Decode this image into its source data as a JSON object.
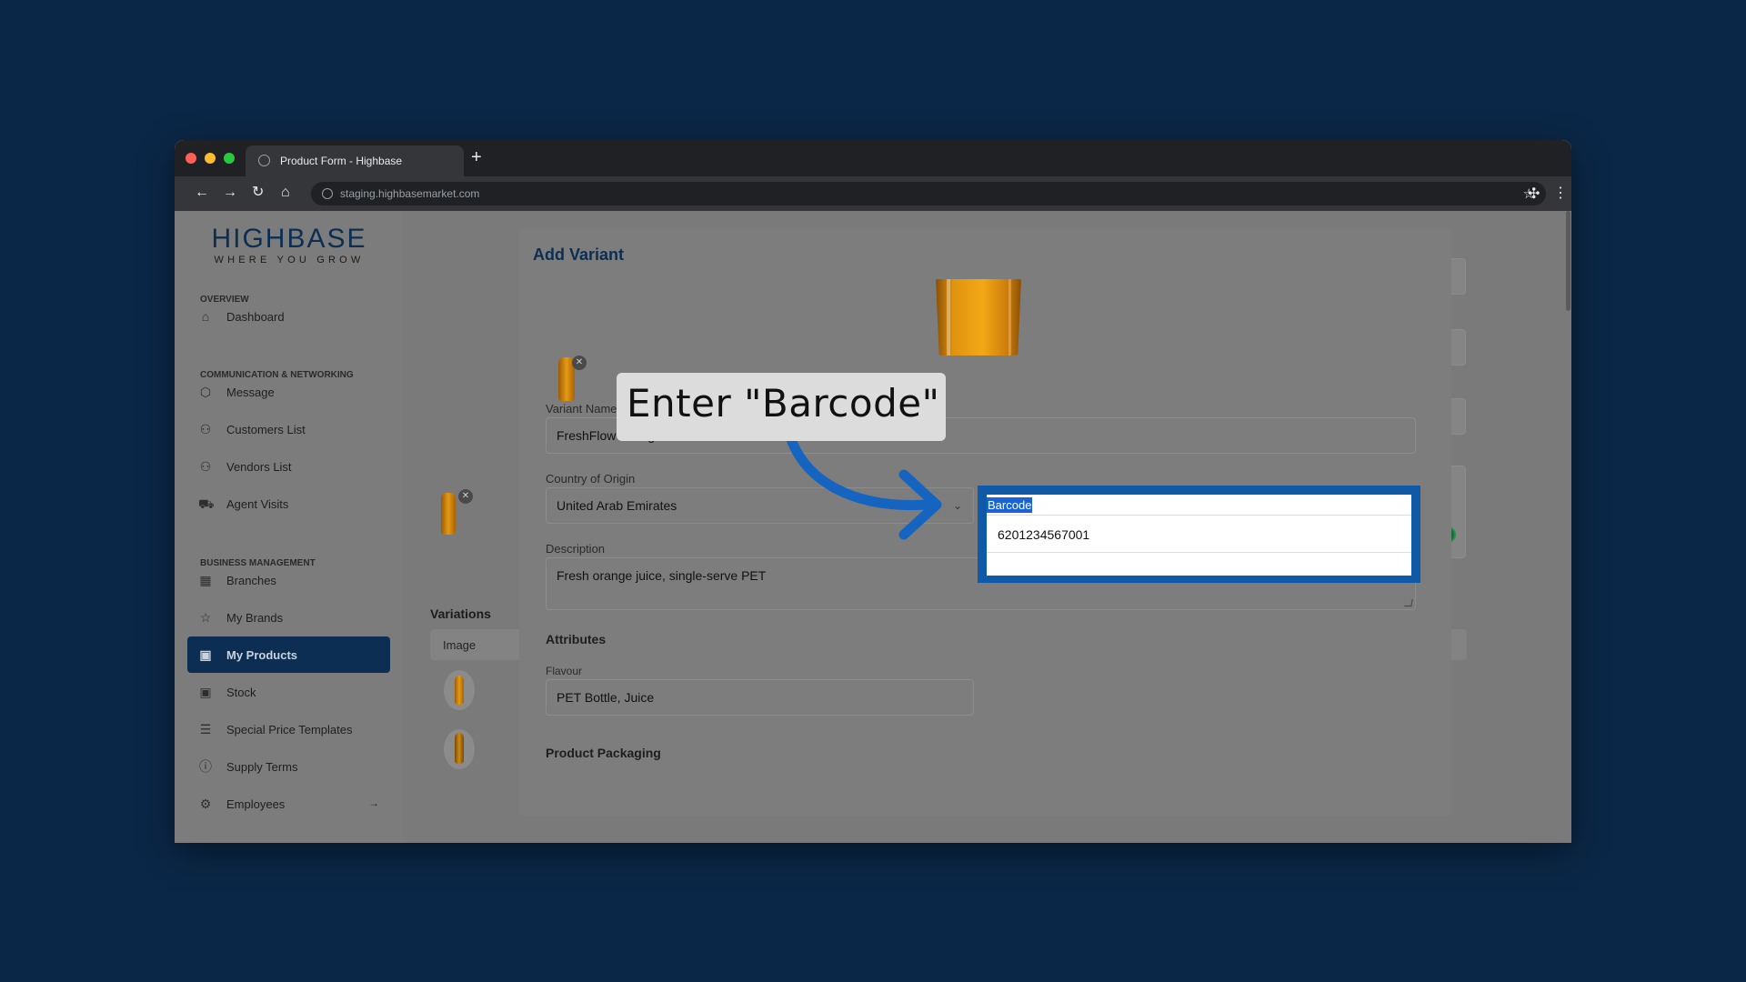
{
  "browser": {
    "tab_title": "Product Form - Highbase",
    "new_tab": "+",
    "url": "staging.highbasemarket.com"
  },
  "logo": {
    "main": "HIGHBASE",
    "tagline": "WHERE YOU GROW"
  },
  "sidebar": {
    "sections": [
      {
        "label": "OVERVIEW"
      },
      {
        "label": "COMMUNICATION & NETWORKING"
      },
      {
        "label": "BUSINESS MANAGEMENT"
      }
    ],
    "items": [
      {
        "label": "Dashboard",
        "icon": "home-icon"
      },
      {
        "label": "Message",
        "icon": "box-icon"
      },
      {
        "label": "Customers List",
        "icon": "users-icon"
      },
      {
        "label": "Vendors List",
        "icon": "users-icon"
      },
      {
        "label": "Agent Visits",
        "icon": "truck-icon"
      },
      {
        "label": "Branches",
        "icon": "store-icon"
      },
      {
        "label": "My Brands",
        "icon": "star-icon"
      },
      {
        "label": "My Products",
        "icon": "archive-icon",
        "active": true
      },
      {
        "label": "Stock",
        "icon": "archive-icon"
      },
      {
        "label": "Special Price Templates",
        "icon": "list-icon"
      },
      {
        "label": "Supply Terms",
        "icon": "info-icon"
      },
      {
        "label": "Employees",
        "icon": "users-cog-icon",
        "arrow": "→"
      }
    ]
  },
  "background_page": {
    "variations_heading": "Variations",
    "table_header_image": "Image"
  },
  "modal": {
    "title": "Add Variant",
    "variant_name": {
      "label": "Variant Name",
      "value": "FreshFlow Orange Juice - 200ml Bottle"
    },
    "country_of_origin": {
      "label": "Country of Origin",
      "value": "United Arab Emirates"
    },
    "barcode": {
      "label": "Barcode",
      "value": "6201234567001"
    },
    "description": {
      "label": "Description",
      "value": "Fresh orange juice, single-serve PET"
    },
    "attributes_heading": "Attributes",
    "flavour": {
      "label": "Flavour",
      "value": "PET Bottle, Juice"
    },
    "packaging_heading": "Product Packaging"
  },
  "callout": {
    "text": "Enter \"Barcode\""
  },
  "colors": {
    "background": "#0b2747",
    "brand_navy": "#0c2e52",
    "highlight": "#0e5aa8",
    "arrow": "#1565c0"
  }
}
